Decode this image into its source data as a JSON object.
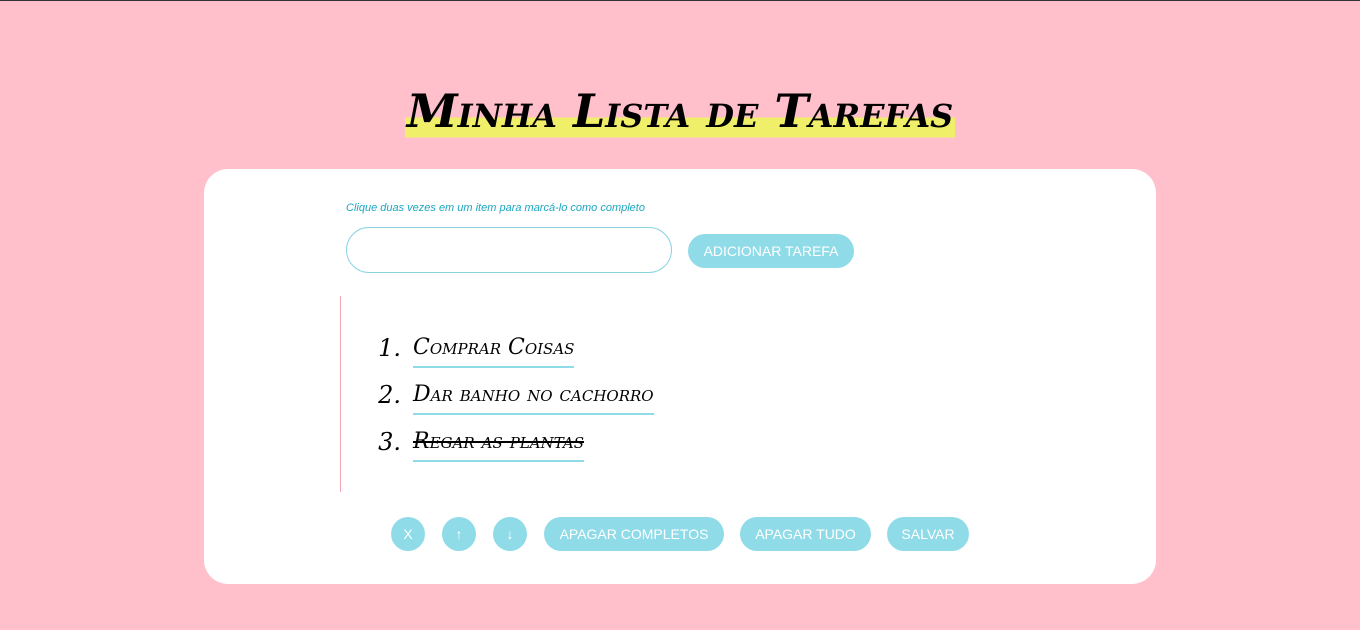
{
  "header": {
    "title": "Minha Lista de Tarefas"
  },
  "form": {
    "hint": "Clique duas vezes em um item para marcá-lo como completo",
    "input_value": "",
    "add_button_label": "Adicionar Tarefa"
  },
  "tasks": [
    {
      "number": "1.",
      "text": "Comprar Coisas",
      "completed": false
    },
    {
      "number": "2.",
      "text": "Dar banho no cachorro",
      "completed": false
    },
    {
      "number": "3.",
      "text": "Regar as plantas",
      "completed": true
    }
  ],
  "controls": {
    "remove_label": "x",
    "move_up_label": "↑",
    "move_down_label": "↓",
    "clear_completed_label": "Apagar Completos",
    "clear_all_label": "Apagar Tudo",
    "save_label": "Salvar"
  },
  "colors": {
    "background": "#ffc0cb",
    "highlight": "#f0ef6a",
    "accent": "#8fdbe8",
    "hint_text": "#1aa7c0"
  }
}
